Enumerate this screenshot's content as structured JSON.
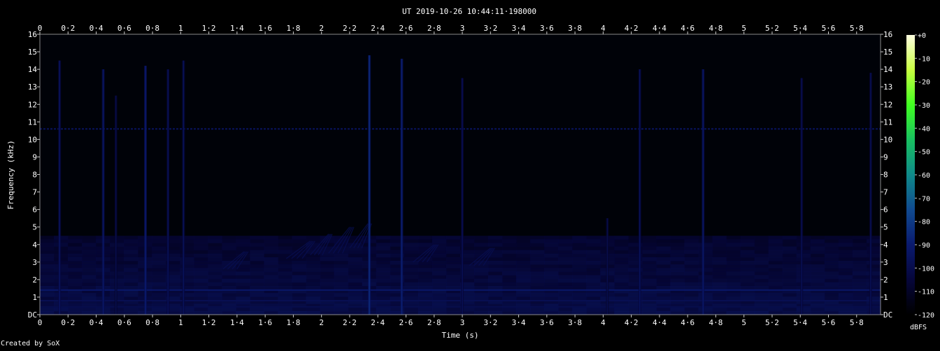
{
  "chart_data": {
    "type": "heatmap",
    "title": "UT 2019-10-26 10:44:11·198000",
    "xlabel": "Time (s)",
    "ylabel": "Frequency (kHz)",
    "xlim": [
      0,
      5.97
    ],
    "ylim": [
      0,
      16
    ],
    "x_ticks": [
      "0",
      "0·2",
      "0·4",
      "0·6",
      "0·8",
      "1",
      "1·2",
      "1·4",
      "1·6",
      "1·8",
      "2",
      "2·2",
      "2·4",
      "2·6",
      "2·8",
      "3",
      "3·2",
      "3·4",
      "3·6",
      "3·8",
      "4",
      "4·2",
      "4·4",
      "4·6",
      "4·8",
      "5",
      "5·2",
      "5·4",
      "5·6",
      "5·8"
    ],
    "y_ticks": [
      "DC",
      "1",
      "2",
      "3",
      "4",
      "5",
      "6",
      "7",
      "8",
      "9",
      "10",
      "11",
      "12",
      "13",
      "14",
      "15",
      "16"
    ],
    "colorbar": {
      "label": "dBFS",
      "range": [
        -120,
        0
      ],
      "ticks": [
        "+0",
        "-10",
        "-20",
        "-30",
        "-40",
        "-50",
        "-60",
        "-70",
        "-80",
        "-90",
        "-100",
        "-110",
        "-120"
      ],
      "colors": [
        "#000000",
        "#06063a",
        "#0a1a6e",
        "#104a90",
        "#0f8a8a",
        "#18c060",
        "#40ff20",
        "#c8ff40",
        "#ffffe0"
      ]
    },
    "background_level_db": -115,
    "noise_band_top_khz": 4.5,
    "horizontal_lines": [
      {
        "freq_khz": 10.6,
        "level_db": -95
      },
      {
        "freq_khz": 1.4,
        "level_db": -92
      },
      {
        "freq_khz": 0.8,
        "level_db": -98
      },
      {
        "freq_khz": 0.45,
        "level_db": -100
      }
    ],
    "vertical_events": [
      {
        "time_s": 0.14,
        "fmax_khz": 14.5,
        "level_db": -95
      },
      {
        "time_s": 0.45,
        "fmax_khz": 14.0,
        "level_db": -92
      },
      {
        "time_s": 0.54,
        "fmax_khz": 12.5,
        "level_db": -100
      },
      {
        "time_s": 0.75,
        "fmax_khz": 14.2,
        "level_db": -90
      },
      {
        "time_s": 0.91,
        "fmax_khz": 14.0,
        "level_db": -97
      },
      {
        "time_s": 1.02,
        "fmax_khz": 14.5,
        "level_db": -96
      },
      {
        "time_s": 2.34,
        "fmax_khz": 14.8,
        "level_db": -85
      },
      {
        "time_s": 2.57,
        "fmax_khz": 14.6,
        "level_db": -88
      },
      {
        "time_s": 3.0,
        "fmax_khz": 13.5,
        "level_db": -98
      },
      {
        "time_s": 4.03,
        "fmax_khz": 5.5,
        "level_db": -100
      },
      {
        "time_s": 4.26,
        "fmax_khz": 14.0,
        "level_db": -96
      },
      {
        "time_s": 4.71,
        "fmax_khz": 14.0,
        "level_db": -92
      },
      {
        "time_s": 5.41,
        "fmax_khz": 13.5,
        "level_db": -98
      },
      {
        "time_s": 5.9,
        "fmax_khz": 13.8,
        "level_db": -98
      }
    ],
    "chirps": [
      {
        "t0": 1.75,
        "t1": 1.92,
        "f0": 3.2,
        "f1": 4.2
      },
      {
        "t0": 1.92,
        "t1": 2.05,
        "f0": 3.4,
        "f1": 4.6
      },
      {
        "t0": 2.05,
        "t1": 2.2,
        "f0": 3.5,
        "f1": 5.0
      },
      {
        "t0": 2.2,
        "t1": 2.33,
        "f0": 3.8,
        "f1": 5.2
      },
      {
        "t0": 1.3,
        "t1": 1.45,
        "f0": 2.6,
        "f1": 3.6
      },
      {
        "t0": 2.65,
        "t1": 2.8,
        "f0": 3.0,
        "f1": 4.0
      },
      {
        "t0": 3.05,
        "t1": 3.2,
        "f0": 2.8,
        "f1": 3.8
      }
    ]
  },
  "footer": {
    "credit": "Created by SoX"
  }
}
